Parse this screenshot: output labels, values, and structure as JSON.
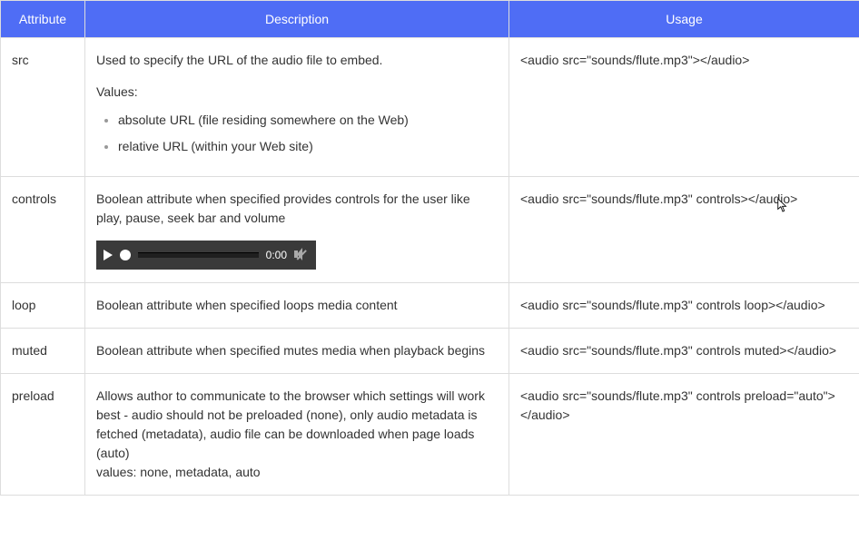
{
  "table": {
    "headers": {
      "attribute": "Attribute",
      "description": "Description",
      "usage": "Usage"
    },
    "rows": [
      {
        "attr": "src",
        "desc_main": "Used to specify the URL of the audio file to embed.",
        "values_label": "Values:",
        "values": [
          "absolute URL (file residing somewhere on the Web)",
          "relative URL (within your Web site)"
        ],
        "usage": "<audio src=\"sounds/flute.mp3\"></audio>"
      },
      {
        "attr": "controls",
        "desc_main": "Boolean attribute when specified provides controls for the user like play, pause, seek bar and volume",
        "player_time": "0:00",
        "usage": "<audio src=\"sounds/flute.mp3\" controls></audio>"
      },
      {
        "attr": "loop",
        "desc_main": "Boolean attribute when specified loops media content",
        "usage": "<audio src=\"sounds/flute.mp3\" controls loop></audio>"
      },
      {
        "attr": "muted",
        "desc_main": "Boolean attribute when specified mutes media when playback begins",
        "usage": "<audio src=\"sounds/flute.mp3\" controls muted></audio>"
      },
      {
        "attr": "preload",
        "desc_main": "Allows author to communicate to the browser which settings will work best - audio should not be preloaded (none), only audio metadata is fetched (metadata), audio file can be downloaded when page loads (auto)",
        "desc_extra": "values: none, metadata, auto",
        "usage": "<audio src=\"sounds/flute.mp3\" controls preload=\"auto\"></audio>"
      }
    ]
  }
}
